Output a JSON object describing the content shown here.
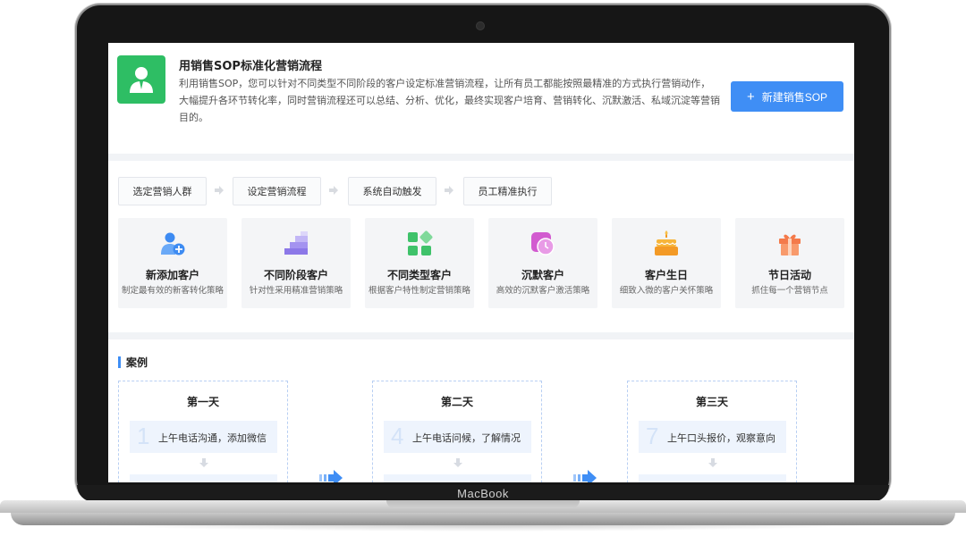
{
  "intro": {
    "title": "用销售SOP标准化营销流程",
    "description": "利用销售SOP，您可以针对不同类型不同阶段的客户设定标准营销流程，让所有员工都能按照最精准的方式执行营销动作，  大幅提升各环节转化率，同时营销流程还可以总结、分析、优化，最终实现客户培育、营销转化、沉默激活、私域沉淀等营销目的。",
    "button": "新建销售SOP",
    "icon": "user-icon"
  },
  "flow": {
    "steps": [
      "选定营销人群",
      "设定营销流程",
      "系统自动触发",
      "员工精准执行"
    ],
    "cards": [
      {
        "title": "新添加客户",
        "desc": "制定最有效的新客转化策略",
        "icon": "add-user-icon"
      },
      {
        "title": "不同阶段客户",
        "desc": "针对性采用精准营销策略",
        "icon": "stairs-icon"
      },
      {
        "title": "不同类型客户",
        "desc": "根据客户特性制定营销策略",
        "icon": "grid-icon"
      },
      {
        "title": "沉默客户",
        "desc": "高效的沉默客户激活策略",
        "icon": "clock-icon"
      },
      {
        "title": "客户生日",
        "desc": "细致入微的客户关怀策略",
        "icon": "cake-icon"
      },
      {
        "title": "节日活动",
        "desc": "抓住每一个营销节点",
        "icon": "gift-icon"
      }
    ]
  },
  "cases": {
    "title": "案例",
    "days": [
      {
        "title": "第一天",
        "task_number": "1",
        "task": "上午电话沟通，添加微信"
      },
      {
        "title": "第二天",
        "task_number": "4",
        "task": "上午电话问候，了解情况"
      },
      {
        "title": "第三天",
        "task_number": "7",
        "task": "上午口头报价，观察意向"
      }
    ]
  },
  "device": {
    "brand": "MacBook"
  },
  "colors": {
    "accent": "#3f8ef5",
    "green": "#2ebe64"
  }
}
